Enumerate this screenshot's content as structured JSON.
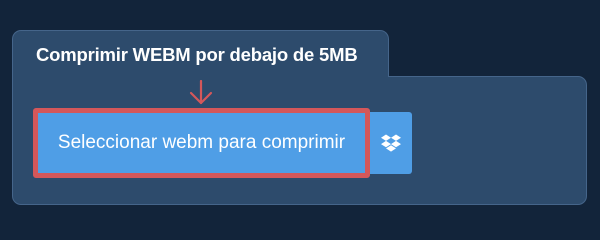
{
  "panel": {
    "title": "Comprimir WEBM por debajo de 5MB"
  },
  "upload": {
    "select_label": "Seleccionar webm para comprimir",
    "dropbox_icon": "dropbox-icon"
  },
  "annotation": {
    "arrow_icon": "arrow-down-icon",
    "highlight_color": "#d4575a"
  },
  "colors": {
    "background": "#12243a",
    "panel": "#2d4b6c",
    "button": "#4f9ee6"
  }
}
